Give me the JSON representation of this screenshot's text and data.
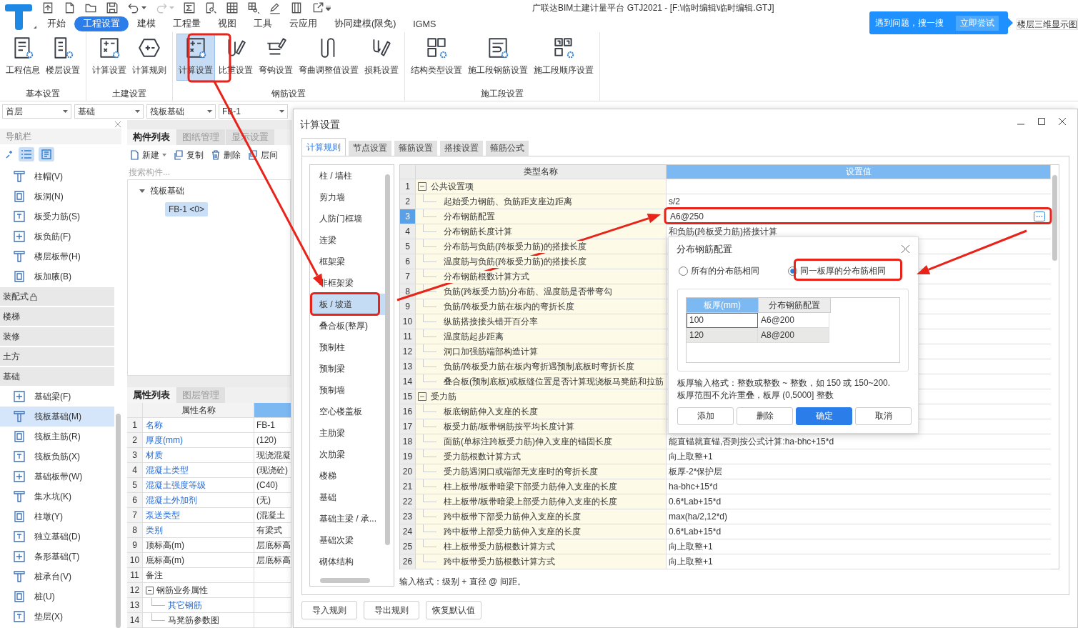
{
  "app": {
    "title": "广联达BIM土建计量平台 GTJ2021 - [F:\\临时编辑\\临时编辑.GTJ]",
    "help_banner": {
      "text": "遇到问题，搜一搜",
      "button": "立即尝试"
    },
    "side_text": "楼层三维显示图"
  },
  "quick_toolbar": {
    "redo_enabled": false
  },
  "menu_tabs": [
    {
      "label": "开始",
      "selected": false
    },
    {
      "label": "工程设置",
      "selected": true
    },
    {
      "label": "建模",
      "selected": false
    },
    {
      "label": "工程量",
      "selected": false
    },
    {
      "label": "视图",
      "selected": false
    },
    {
      "label": "工具",
      "selected": false
    },
    {
      "label": "云应用",
      "selected": false
    },
    {
      "label": "协同建模(限免)",
      "selected": false
    },
    {
      "label": "IGMS",
      "selected": false
    }
  ],
  "ribbon_groups": [
    {
      "title": "基本设置",
      "buttons": [
        {
          "label": "工程信息",
          "selected": false
        },
        {
          "label": "楼层设置",
          "selected": false
        }
      ]
    },
    {
      "title": "土建设置",
      "buttons": [
        {
          "label": "计算设置",
          "selected": false
        },
        {
          "label": "计算规则",
          "selected": false
        }
      ]
    },
    {
      "title": "钢筋设置",
      "buttons": [
        {
          "label": "计算设置",
          "selected": true
        },
        {
          "label": "比重设置",
          "selected": false
        },
        {
          "label": "弯钩设置",
          "selected": false
        },
        {
          "label": "弯曲调整值设置",
          "selected": false
        },
        {
          "label": "损耗设置",
          "selected": false
        }
      ]
    },
    {
      "title": "施工段设置",
      "buttons": [
        {
          "label": "结构类型设置",
          "selected": false
        },
        {
          "label": "施工段钢筋设置",
          "selected": false
        },
        {
          "label": "施工段顺序设置",
          "selected": false
        }
      ]
    }
  ],
  "selectors": [
    {
      "value": "首层"
    },
    {
      "value": "基础"
    },
    {
      "value": "筏板基础"
    },
    {
      "value": "FB-1"
    }
  ],
  "nav": {
    "title": "导航栏",
    "view_modes": [
      {
        "selected": true
      },
      {
        "selected": true
      }
    ],
    "items": [
      {
        "kind": "item",
        "label": "柱帽(V)",
        "selected": false
      },
      {
        "kind": "item",
        "label": "板洞(N)",
        "selected": false
      },
      {
        "kind": "item",
        "label": "板受力筋(S)",
        "selected": false
      },
      {
        "kind": "item",
        "label": "板负筋(F)",
        "selected": false
      },
      {
        "kind": "item",
        "label": "楼层板带(H)",
        "selected": false
      },
      {
        "kind": "item",
        "label": "板加腋(B)",
        "selected": false
      },
      {
        "kind": "category",
        "label": "装配式",
        "locked": true
      },
      {
        "kind": "category",
        "label": "楼梯",
        "locked": false
      },
      {
        "kind": "category",
        "label": "装修",
        "locked": false
      },
      {
        "kind": "category",
        "label": "土方",
        "locked": false
      },
      {
        "kind": "category",
        "label": "基础",
        "locked": false
      },
      {
        "kind": "item",
        "label": "基础梁(F)",
        "selected": false
      },
      {
        "kind": "item",
        "label": "筏板基础(M)",
        "selected": true
      },
      {
        "kind": "item",
        "label": "筏板主筋(R)",
        "selected": false
      },
      {
        "kind": "item",
        "label": "筏板负筋(X)",
        "selected": false
      },
      {
        "kind": "item",
        "label": "基础板带(W)",
        "selected": false
      },
      {
        "kind": "item",
        "label": "集水坑(K)",
        "selected": false
      },
      {
        "kind": "item",
        "label": "柱墩(Y)",
        "selected": false
      },
      {
        "kind": "item",
        "label": "独立基础(D)",
        "selected": false
      },
      {
        "kind": "item",
        "label": "条形基础(T)",
        "selected": false
      },
      {
        "kind": "item",
        "label": "桩承台(V)",
        "selected": false
      },
      {
        "kind": "item",
        "label": "桩(U)",
        "selected": false
      },
      {
        "kind": "item",
        "label": "垫层(X)",
        "selected": false
      }
    ]
  },
  "component_panel": {
    "tabs": [
      {
        "label": "构件列表",
        "selected": true
      },
      {
        "label": "图纸管理",
        "selected": false
      },
      {
        "label": "显示设置",
        "selected": false
      }
    ],
    "toolbar": [
      {
        "label": "新建"
      },
      {
        "label": "复制"
      },
      {
        "label": "删除"
      },
      {
        "label": "层间"
      }
    ],
    "search": {
      "placeholder": "搜索构件..."
    },
    "tree": [
      {
        "label": "筏板基础",
        "expanded": true,
        "children": [
          {
            "label": "FB-1 <0>",
            "selected": true
          }
        ]
      }
    ]
  },
  "property_panel": {
    "tabs": [
      {
        "label": "属性列表",
        "selected": true
      },
      {
        "label": "图层管理",
        "selected": false
      }
    ],
    "columns": [
      {
        "label": "属性名称",
        "selected": false
      },
      {
        "selected": true
      }
    ],
    "rows": [
      {
        "no": "1",
        "kind": "item",
        "name": "名称",
        "value": "FB-1",
        "link": true
      },
      {
        "no": "2",
        "kind": "item",
        "name": "厚度(mm)",
        "value": "(120)",
        "link": true
      },
      {
        "no": "3",
        "kind": "item",
        "name": "材质",
        "value": "现浇混凝",
        "link": true
      },
      {
        "no": "4",
        "kind": "item",
        "name": "混凝土类型",
        "value": "(现浇砼)",
        "link": true
      },
      {
        "no": "5",
        "kind": "item",
        "name": "混凝土强度等级",
        "value": "(C40)",
        "link": true
      },
      {
        "no": "6",
        "kind": "item",
        "name": "混凝土外加剂",
        "value": "(无)",
        "link": true
      },
      {
        "no": "7",
        "kind": "item",
        "name": "泵送类型",
        "value": "(混凝土",
        "link": true
      },
      {
        "no": "8",
        "kind": "item",
        "name": "类别",
        "value": "有梁式",
        "link": true
      },
      {
        "no": "9",
        "kind": "item",
        "name": "顶标高(m)",
        "value": "层底标高",
        "link": false
      },
      {
        "no": "10",
        "kind": "item",
        "name": "底标高(m)",
        "value": "层底标高",
        "link": false
      },
      {
        "no": "11",
        "kind": "item",
        "name": "备注",
        "link": false
      },
      {
        "no": "12",
        "kind": "group",
        "name": "钢筋业务属性",
        "expanded": true
      },
      {
        "no": "13",
        "kind": "child",
        "name": "其它钢筋",
        "link": true
      },
      {
        "no": "14",
        "kind": "child",
        "name": "马凳筋参数图",
        "link": false
      }
    ]
  },
  "dialog": {
    "title": "计算设置",
    "tabs": [
      {
        "label": "计算规则",
        "selected": true
      },
      {
        "label": "节点设置",
        "selected": false
      },
      {
        "label": "箍筋设置",
        "selected": false
      },
      {
        "label": "搭接设置",
        "selected": false
      },
      {
        "label": "箍筋公式",
        "selected": false
      }
    ],
    "categories": [
      {
        "label": "柱 / 墙柱",
        "selected": false
      },
      {
        "label": "剪力墙",
        "selected": false
      },
      {
        "label": "人防门框墙",
        "selected": false
      },
      {
        "label": "连梁",
        "selected": false
      },
      {
        "label": "框架梁",
        "selected": false
      },
      {
        "label": "非框架梁",
        "selected": false
      },
      {
        "label": "板 / 坡道",
        "selected": true
      },
      {
        "label": "叠合板(整厚)",
        "selected": false
      },
      {
        "label": "预制柱",
        "selected": false
      },
      {
        "label": "预制梁",
        "selected": false
      },
      {
        "label": "预制墙",
        "selected": false
      },
      {
        "label": "空心楼盖板",
        "selected": false
      },
      {
        "label": "主肋梁",
        "selected": false
      },
      {
        "label": "次肋梁",
        "selected": false
      },
      {
        "label": "楼梯",
        "selected": false
      },
      {
        "label": "基础",
        "selected": false
      },
      {
        "label": "基础主梁 / 承...",
        "selected": false
      },
      {
        "label": "基础次梁",
        "selected": false
      },
      {
        "label": "砌体结构",
        "selected": false
      }
    ],
    "table": {
      "columns": [
        {
          "label": "类型名称",
          "selected": false
        },
        {
          "label": "设置值",
          "selected": true
        }
      ],
      "rows": [
        {
          "no": "1",
          "kind": "group",
          "name": "公共设置项",
          "expanded": true,
          "selected": false
        },
        {
          "no": "2",
          "kind": "item",
          "name": "起始受力钢筋、负筋距支座边距离",
          "value": "s/2",
          "selected": false
        },
        {
          "no": "3",
          "kind": "item",
          "name": "分布钢筋配置",
          "value": "A6@250",
          "selected": true
        },
        {
          "no": "4",
          "kind": "item",
          "name": "分布钢筋长度计算",
          "value": "和负筋(跨板受力筋)搭接计算",
          "selected": false
        },
        {
          "no": "5",
          "kind": "item",
          "name": "分布筋与负筋(跨板受力筋)的搭接长度",
          "selected": false
        },
        {
          "no": "6",
          "kind": "item",
          "name": "温度筋与负筋(跨板受力筋)的搭接长度",
          "selected": false
        },
        {
          "no": "7",
          "kind": "item",
          "name": "分布钢筋根数计算方式",
          "selected": false
        },
        {
          "no": "8",
          "kind": "item",
          "name": "负筋(跨板受力筋)分布筋、温度筋是否带弯勾",
          "selected": false
        },
        {
          "no": "9",
          "kind": "item",
          "name": "负筋/跨板受力筋在板内的弯折长度",
          "selected": false
        },
        {
          "no": "10",
          "kind": "item",
          "name": "纵筋搭接接头错开百分率",
          "selected": false
        },
        {
          "no": "11",
          "kind": "item",
          "name": "温度筋起步距离",
          "selected": false
        },
        {
          "no": "12",
          "kind": "item",
          "name": "洞口加强筋端部构造计算",
          "selected": false
        },
        {
          "no": "13",
          "kind": "item",
          "name": "负筋/跨板受力筋在板内弯折遇预制底板时弯折长度",
          "selected": false
        },
        {
          "no": "14",
          "kind": "item",
          "name": "叠合板(预制底板)或板缝位置是否计算现浇板马凳筋和拉筋",
          "selected": false
        },
        {
          "no": "15",
          "kind": "group",
          "name": "受力筋",
          "expanded": true,
          "selected": false
        },
        {
          "no": "16",
          "kind": "item",
          "name": "板底钢筋伸入支座的长度",
          "selected": false
        },
        {
          "no": "17",
          "kind": "item",
          "name": "板受力筋/板带钢筋按平均长度计算",
          "selected": false
        },
        {
          "no": "18",
          "kind": "item",
          "name": "面筋(单标注跨板受力筋)伸入支座的锚固长度",
          "value": "能直锚就直锚,否则按公式计算:ha-bhc+15*d",
          "selected": false
        },
        {
          "no": "19",
          "kind": "item",
          "name": "受力筋根数计算方式",
          "value": "向上取整+1",
          "selected": false
        },
        {
          "no": "20",
          "kind": "item",
          "name": "受力筋遇洞口或端部无支座时的弯折长度",
          "value": "板厚-2*保护层",
          "selected": false
        },
        {
          "no": "21",
          "kind": "item",
          "name": "柱上板带/板带暗梁下部受力筋伸入支座的长度",
          "value": "ha-bhc+15*d",
          "selected": false
        },
        {
          "no": "22",
          "kind": "item",
          "name": "柱上板带/板带暗梁上部受力筋伸入支座的长度",
          "value": "0.6*Lab+15*d",
          "selected": false
        },
        {
          "no": "23",
          "kind": "item",
          "name": "跨中板带下部受力筋伸入支座的长度",
          "value": "max(ha/2,12*d)",
          "selected": false
        },
        {
          "no": "24",
          "kind": "item",
          "name": "跨中板带上部受力筋伸入支座的长度",
          "value": "0.6*Lab+15*d",
          "selected": false
        },
        {
          "no": "25",
          "kind": "item",
          "name": "柱上板带受力筋根数计算方式",
          "value": "向上取整+1",
          "selected": false
        },
        {
          "no": "26",
          "kind": "item",
          "name": "跨中板带受力筋根数计算方式",
          "value": "向上取整+1",
          "selected": false
        }
      ]
    },
    "hint": "输入格式：级别 + 直径 @ 间距。",
    "buttons": [
      {
        "label": "导入规则"
      },
      {
        "label": "导出规则"
      },
      {
        "label": "恢复默认值"
      }
    ]
  },
  "subdialog": {
    "title": "分布钢筋配置",
    "options": [
      {
        "label": "所有的分布筋相同",
        "selected": false
      },
      {
        "label": "同一板厚的分布筋相同",
        "selected": true
      }
    ],
    "columns": [
      {
        "label": "板厚(mm)",
        "selected": true
      },
      {
        "label": "分布钢筋配置",
        "selected": false
      }
    ],
    "rows": [
      {
        "cells": [
          "100",
          "A6@200"
        ],
        "selected": true
      },
      {
        "cells": [
          "120",
          "A8@200"
        ],
        "selected": false
      }
    ],
    "notes": [
      "板厚输入格式：整数或整数 ~ 整数，如 150 或 150~200.",
      "板厚范围不允许重叠，板厚 (0,5000] 整数"
    ],
    "buttons": [
      {
        "label": "添加",
        "primary": false
      },
      {
        "label": "删除",
        "primary": false
      },
      {
        "label": "确定",
        "primary": true
      },
      {
        "label": "取消",
        "primary": false
      }
    ]
  }
}
